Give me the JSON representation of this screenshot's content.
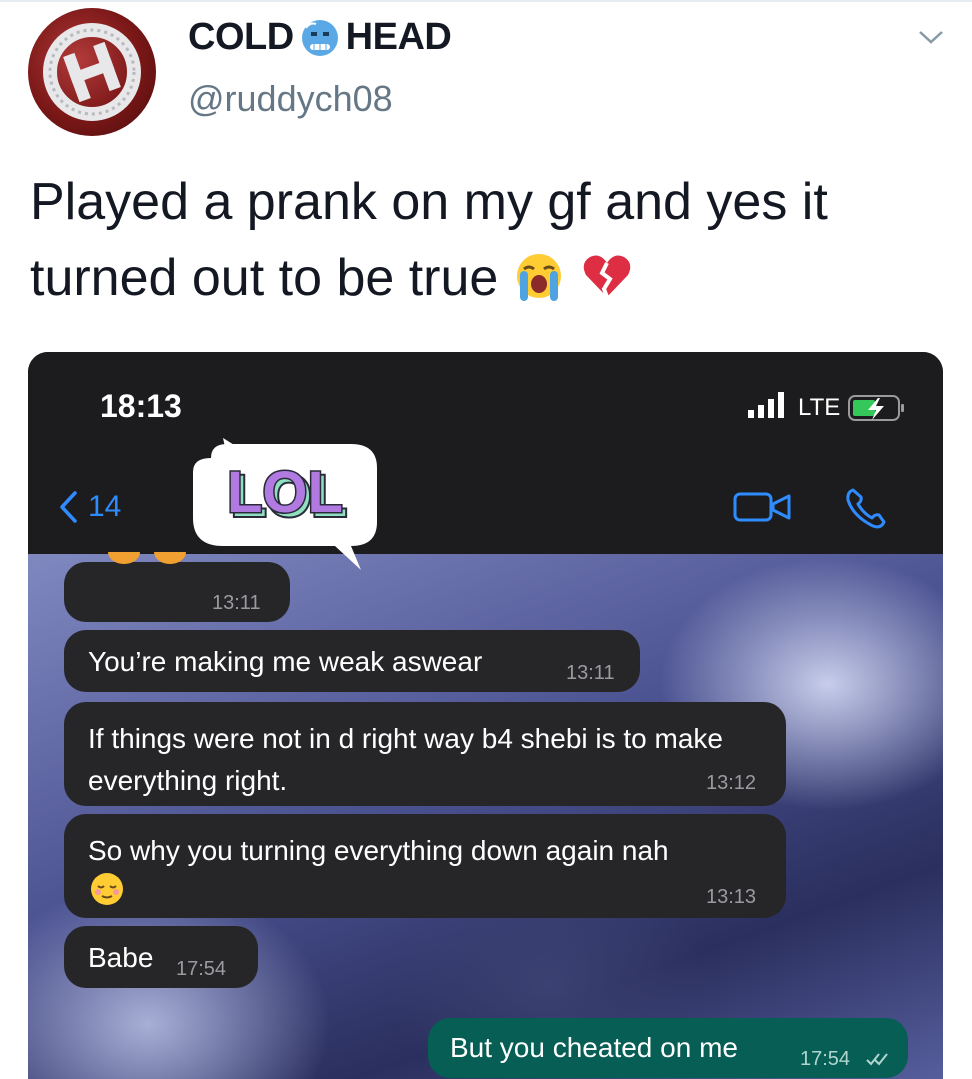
{
  "tweet": {
    "author_name_part1": "COLD",
    "author_name_part2": "HEAD",
    "author_handle": "@ruddych08",
    "text": "Played a prank on my gf and yes it turned out to be true",
    "emoji_icons": [
      "loudly-crying-face-icon",
      "broken-heart-icon"
    ]
  },
  "phone": {
    "status_time": "18:13",
    "network": "LTE",
    "back_count": "14",
    "sticker_text": "LOL",
    "messages": [
      {
        "text": "",
        "time": "13:11",
        "side": "received"
      },
      {
        "text": "You’re making me weak aswear",
        "time": "13:11",
        "side": "received"
      },
      {
        "text": "If things were not in d right way b4 shebi is to make everything right.",
        "time": "13:12",
        "side": "received"
      },
      {
        "text": "So why you turning everything down again nah",
        "time": "13:13",
        "side": "received",
        "emoji": "relieved-face-icon"
      },
      {
        "text": "Babe",
        "time": "17:54",
        "side": "received"
      },
      {
        "text": "But you cheated on me",
        "time": "17:54",
        "side": "sent"
      }
    ]
  },
  "colors": {
    "ios_blue": "#2f8cff",
    "bubble_received": "#262628",
    "bubble_sent": "#075e54",
    "handle_gray": "#657786"
  }
}
